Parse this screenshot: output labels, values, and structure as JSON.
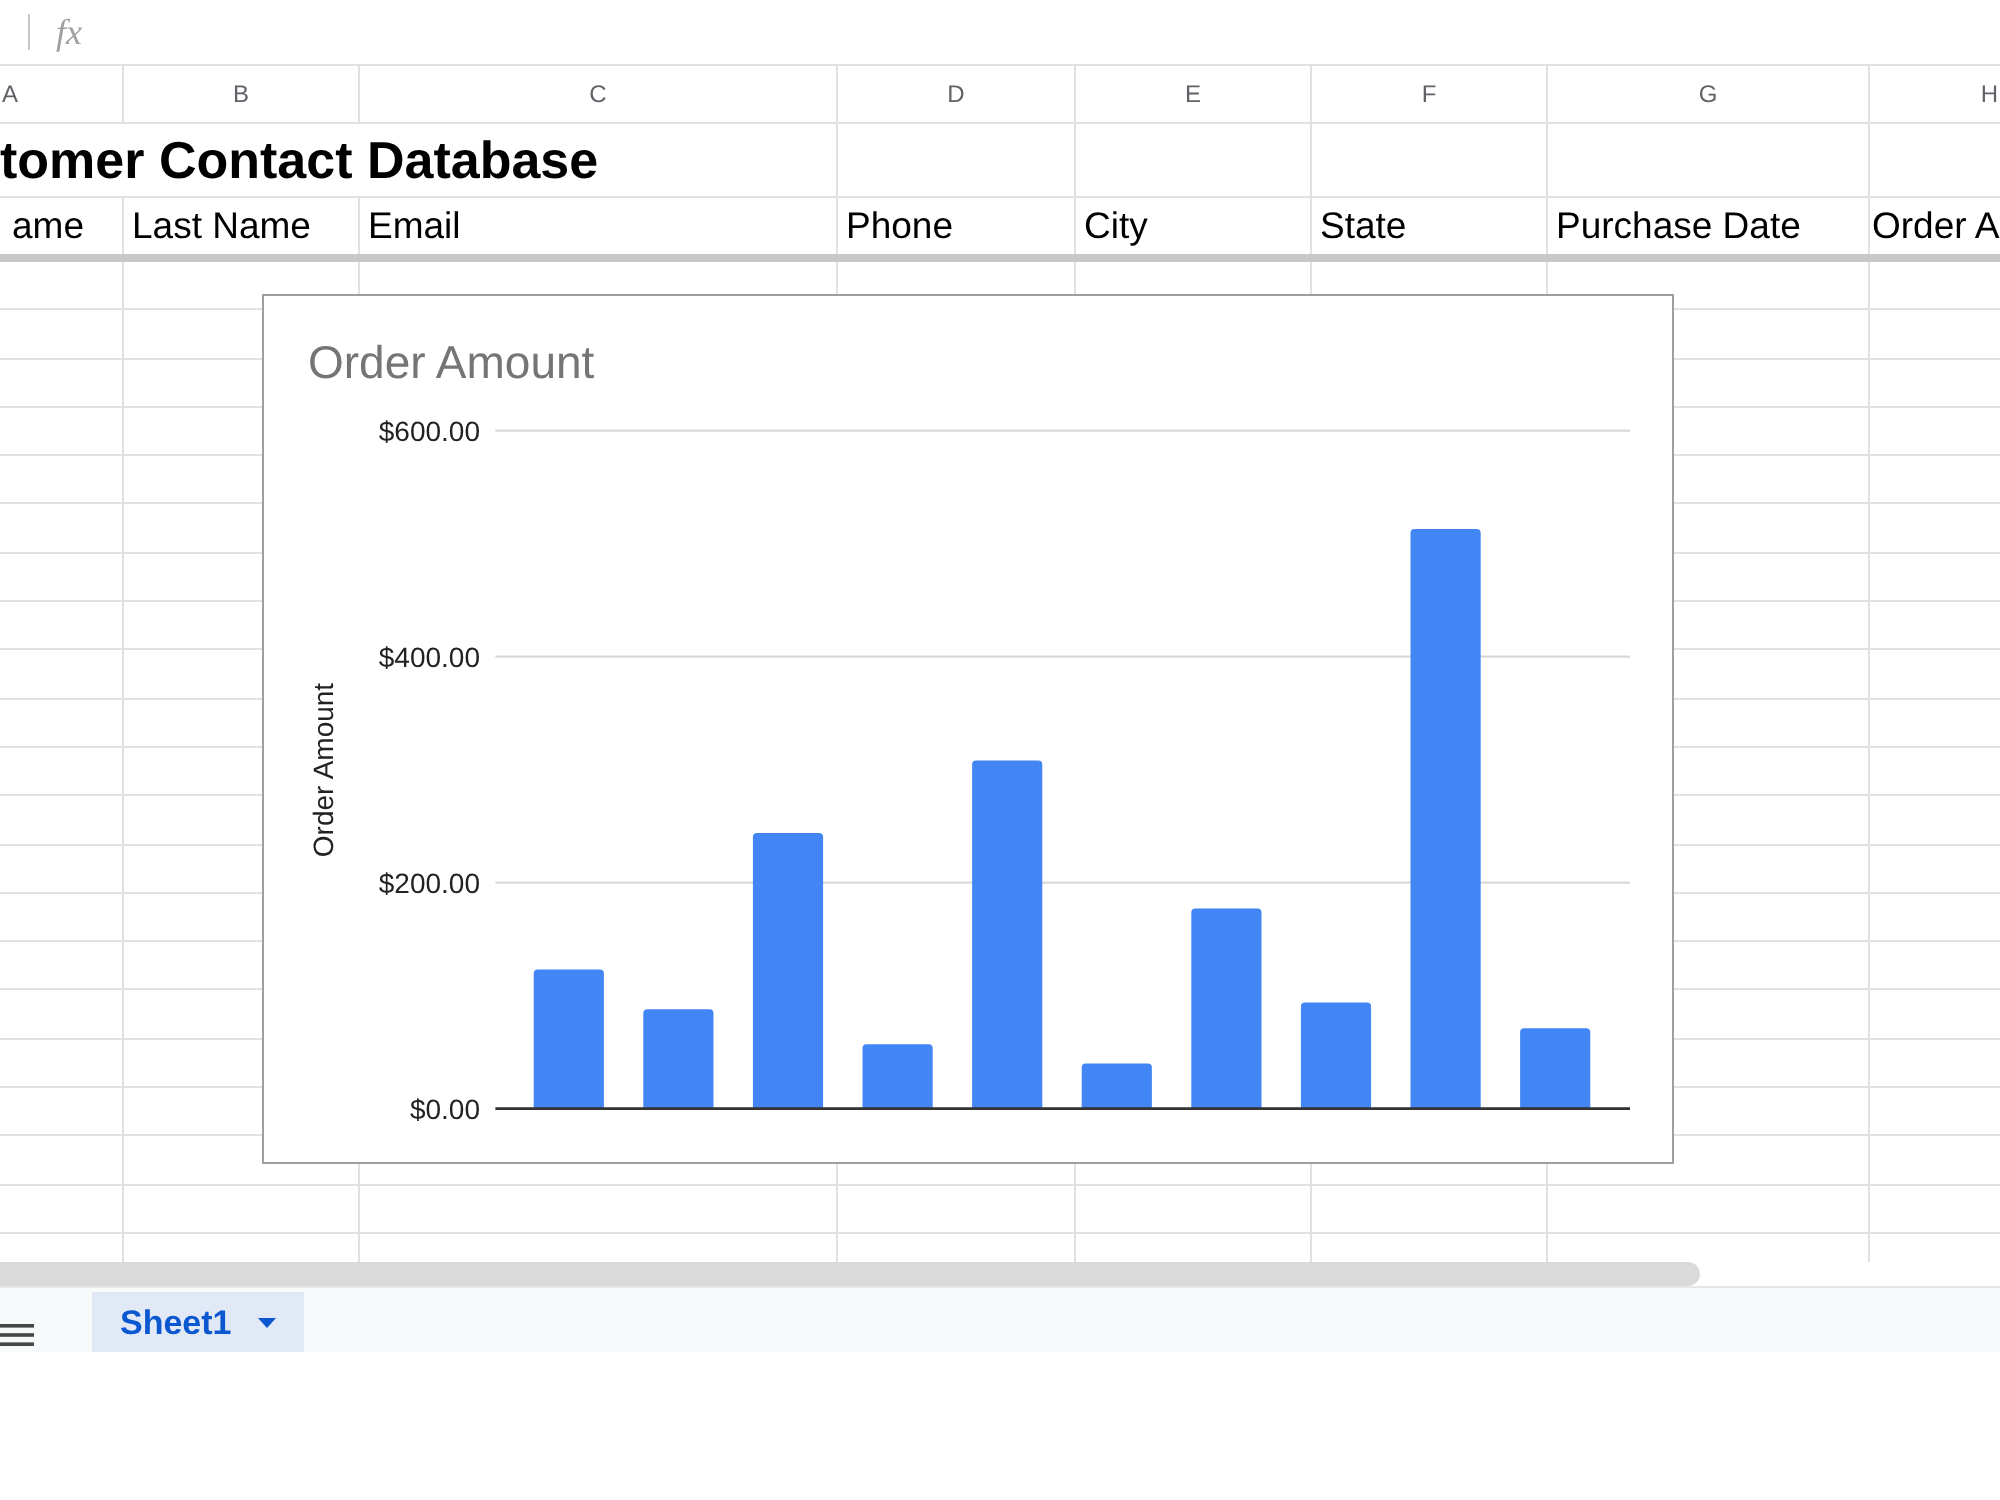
{
  "formula_bar": {
    "function_symbol": "fx"
  },
  "columns": [
    {
      "label": "A"
    },
    {
      "label": "B"
    },
    {
      "label": "C"
    },
    {
      "label": "D"
    },
    {
      "label": "E"
    },
    {
      "label": "F"
    },
    {
      "label": "G"
    },
    {
      "label": "H"
    }
  ],
  "title_row": {
    "text": "tomer Contact Database"
  },
  "header_row": [
    "ame",
    "Last Name",
    "Email",
    "Phone",
    "City",
    "State",
    "Purchase Date",
    "Order A"
  ],
  "chart": {
    "chart_data": {
      "type": "bar",
      "title": "Order Amount",
      "ylabel": "Order Amount",
      "series": [
        {
          "color": "#4285f4",
          "values": [
            123,
            88,
            244,
            57,
            308,
            40,
            177,
            94,
            513,
            71
          ]
        }
      ],
      "ylim": [
        0,
        600
      ],
      "yticks": [
        {
          "value": 0,
          "label": "$0.00"
        },
        {
          "value": 200,
          "label": "$200.00"
        },
        {
          "value": 400,
          "label": "$400.00"
        },
        {
          "value": 600,
          "label": "$600.00"
        }
      ]
    }
  },
  "sheet_tabs": [
    {
      "label": "Sheet1",
      "selected": true
    }
  ]
}
